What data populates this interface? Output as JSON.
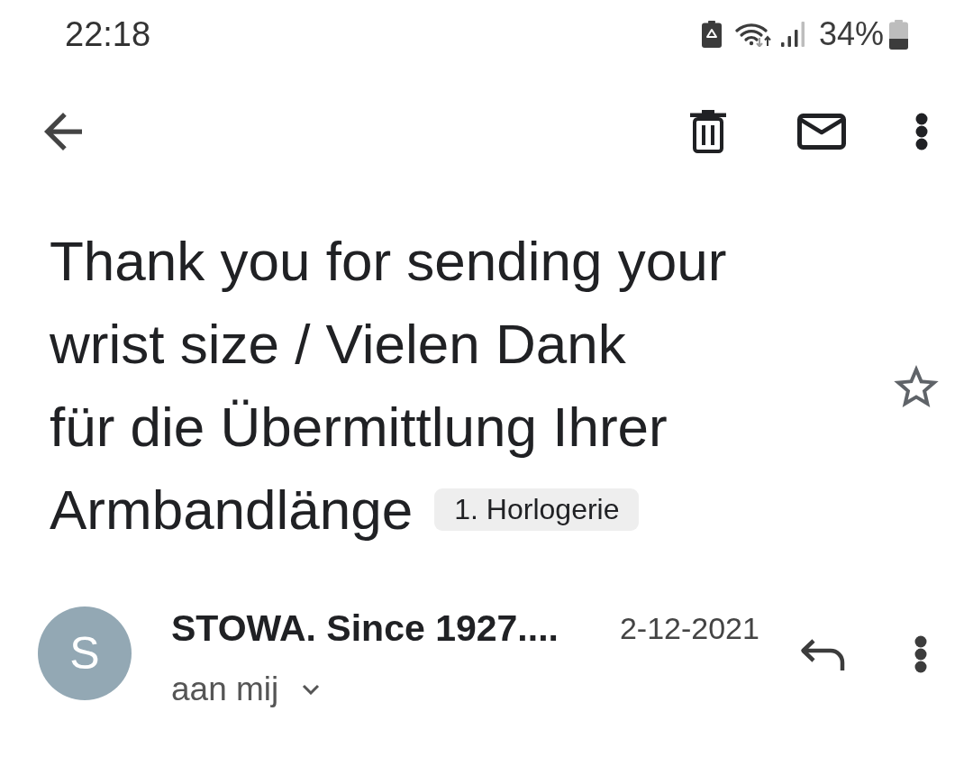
{
  "status_bar": {
    "time": "22:18",
    "battery_percent": "34%"
  },
  "subject_lines": [
    "Thank you for sending your",
    "wrist size / Vielen Dank",
    "für die Übermittlung Ihrer",
    "Armbandlänge"
  ],
  "labels": [
    {
      "text": "1. Horlogerie"
    }
  ],
  "starred": false,
  "message": {
    "avatar_letter": "S",
    "sender": "STOWA. Since 1927....",
    "date": "2-12-2021",
    "recipient": "aan mij"
  }
}
